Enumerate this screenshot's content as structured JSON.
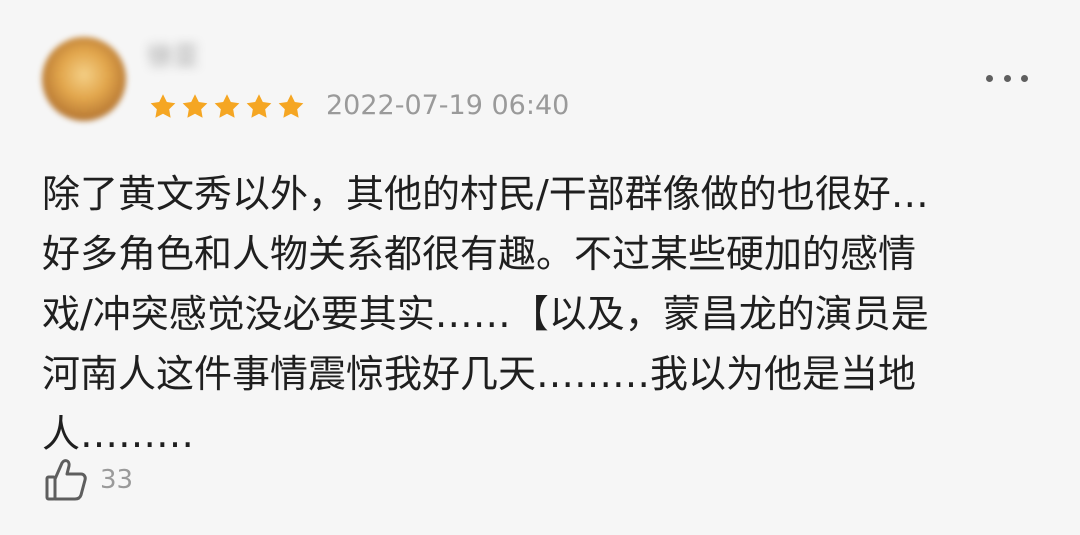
{
  "review": {
    "username": "徐亚",
    "rating_stars": 5,
    "star_color": "#f5a623",
    "date": "2022-07-19 06:40",
    "more_icon": "more-horizontal-icon",
    "body_lines": [
      "除了黄文秀以外，其他的村民/干部群像做的也很好…",
      "好多角色和人物关系都很有趣。不过某些硬加的感情",
      "戏/冲突感觉没必要其实……【以及，蒙昌龙的演员是",
      "河南人这件事情震惊我好几天………我以为他是当地",
      "人………"
    ],
    "like_icon": "thumbs-up-icon",
    "like_count": "33"
  }
}
